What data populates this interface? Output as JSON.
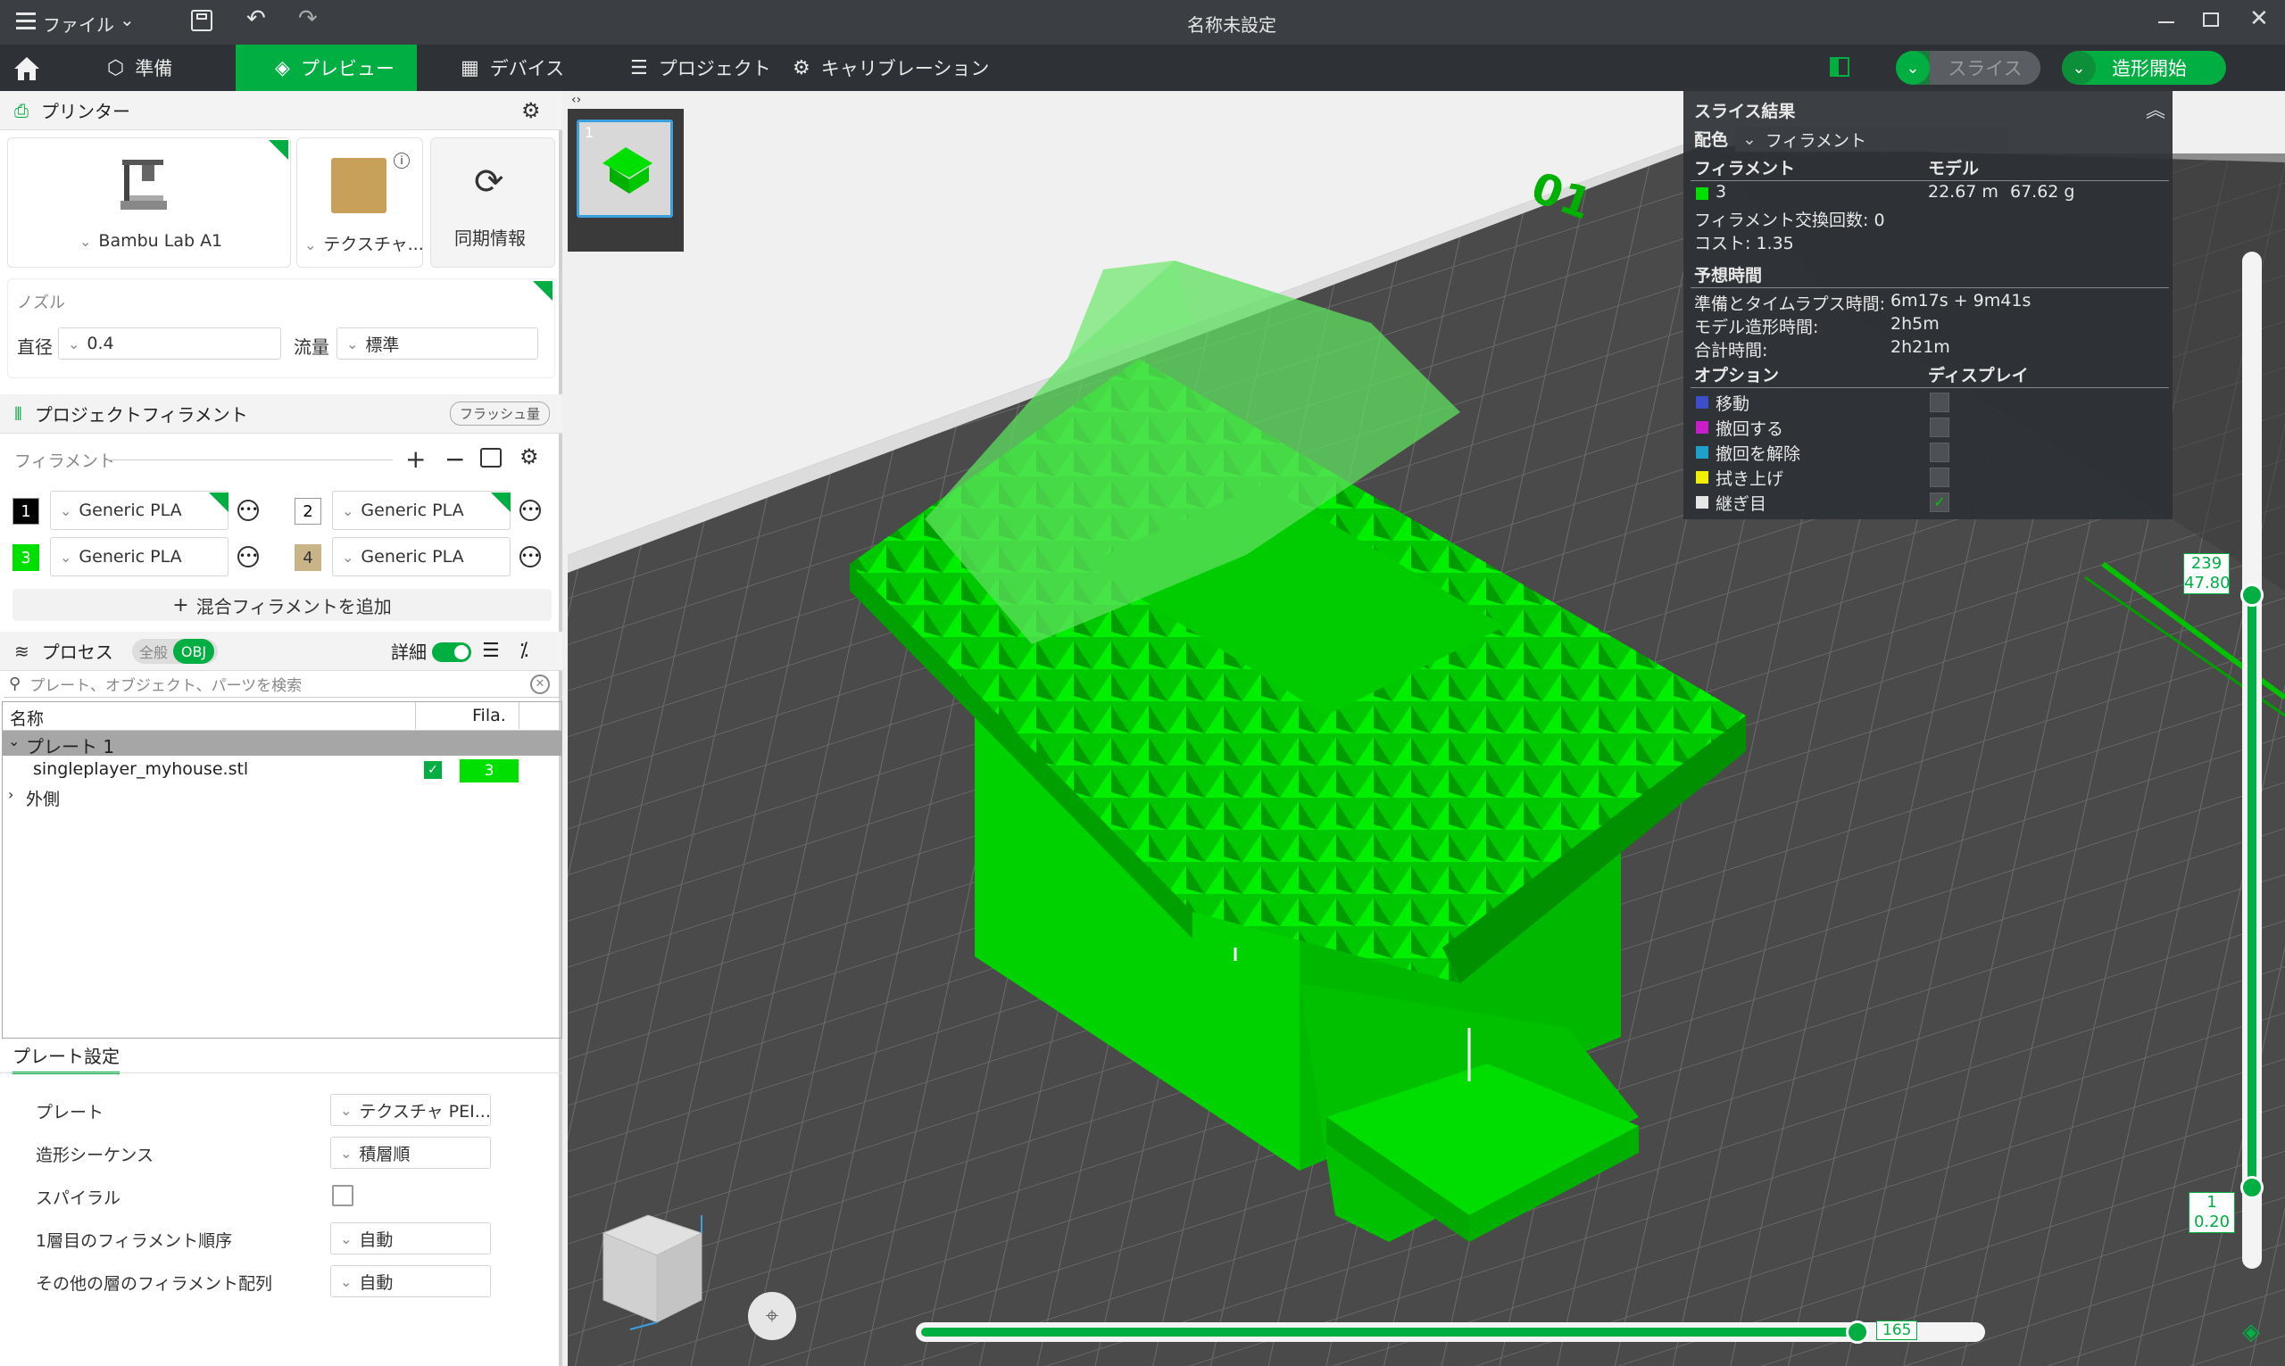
{
  "window": {
    "title": "名称未設定",
    "menu_label": "ファイル"
  },
  "nav": {
    "tabs": [
      {
        "label": "準備"
      },
      {
        "label": "プレビュー"
      },
      {
        "label": "デバイス"
      },
      {
        "label": "プロジェクト"
      },
      {
        "label": "キャリブレーション"
      }
    ],
    "slice_label": "スライス",
    "print_label": "造形開始"
  },
  "printer": {
    "section_label": "プリンター",
    "printer_name": "Bambu Lab A1",
    "plate_name": "テクスチャ...",
    "sync_label": "同期情報",
    "nozzle_label": "ノズル",
    "diameter_label": "直径",
    "diameter_value": "0.4",
    "flow_label": "流量",
    "flow_value": "標準"
  },
  "filament": {
    "section_label": "プロジェクトフィラメント",
    "flush_label": "フラッシュ量",
    "sub_label": "フィラメント",
    "items": [
      {
        "num": "1",
        "name": "Generic PLA",
        "color": "#000000"
      },
      {
        "num": "2",
        "name": "Generic PLA",
        "color": "#ffffff"
      },
      {
        "num": "3",
        "name": "Generic PLA",
        "color": "#00e000"
      },
      {
        "num": "4",
        "name": "Generic PLA",
        "color": "#c8b487"
      }
    ],
    "add_mixed": "混合フィラメントを追加"
  },
  "process": {
    "section_label": "プロセス",
    "toggle_all": "全般",
    "toggle_obj": "OBJ",
    "detail_label": "詳細",
    "search_placeholder": "プレート、オブジェクト、パーツを検索",
    "col_name": "名称",
    "col_fila": "Fila.",
    "plate_row": "プレート 1",
    "object_name": "singleplayer_myhouse.stl",
    "object_fila": "3",
    "outer_row": "外側"
  },
  "plate_settings": {
    "tab": "プレート設定",
    "rows": [
      {
        "label": "プレート",
        "value": "テクスチャ PEI..."
      },
      {
        "label": "造形シーケンス",
        "value": "積層順"
      },
      {
        "label": "スパイラル",
        "value": ""
      },
      {
        "label": "1層目のフィラメント順序",
        "value": "自動"
      },
      {
        "label": "その他の層のフィラメント配列",
        "value": "自動"
      }
    ]
  },
  "viewport": {
    "thumb_num": "1",
    "bed_label": "01",
    "layer_top": "239",
    "height_top": "47.80",
    "layer_bottom": "1",
    "height_bottom": "0.20",
    "move_value": "165"
  },
  "results": {
    "title": "スライス結果",
    "color_scheme_label": "配色",
    "color_scheme_value": "フィラメント",
    "col_filament": "フィラメント",
    "col_model": "モデル",
    "filament_id": "3",
    "length": "22.67 m",
    "weight": "67.62 g",
    "changes": "フィラメント交換回数: 0",
    "cost": "コスト: 1.35",
    "time_header": "予想時間",
    "prep_label": "準備とタイムラプス時間:",
    "prep_value": "6m17s + 9m41s",
    "model_time_label": "モデル造形時間:",
    "model_time_value": "2h5m",
    "total_label": "合計時間:",
    "total_value": "2h21m",
    "options_header": "オプション",
    "display_header": "ディスプレイ",
    "options": [
      {
        "label": "移動",
        "color": "#3c4ec8"
      },
      {
        "label": "撤回する",
        "color": "#c81ec8"
      },
      {
        "label": "撤回を解除",
        "color": "#1ea0c8"
      },
      {
        "label": "拭き上げ",
        "color": "#f0f000"
      },
      {
        "label": "継ぎ目",
        "color": "#e6e6e6"
      }
    ]
  },
  "colors": {
    "accent": "#00ae42",
    "model_green": "#00e000"
  }
}
